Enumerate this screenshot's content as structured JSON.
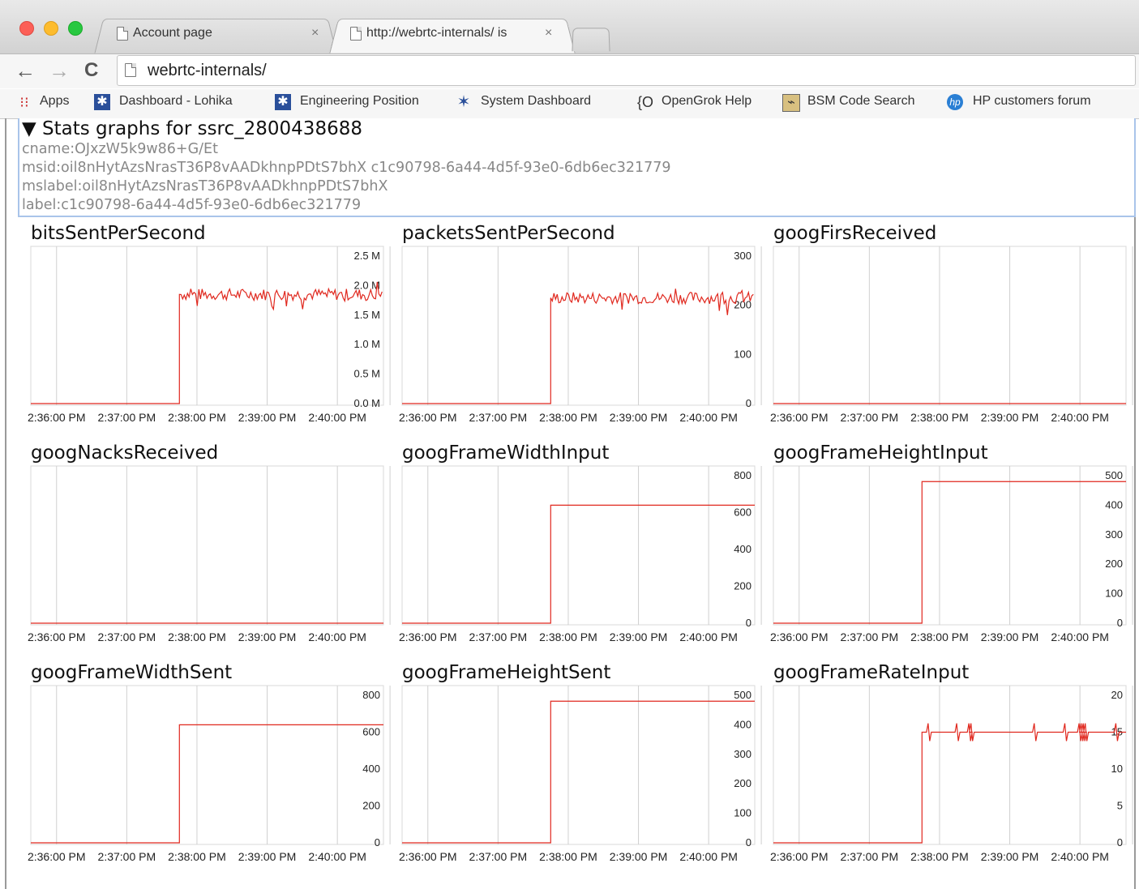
{
  "browser": {
    "tabs": [
      {
        "title": "Account page",
        "close": "×"
      },
      {
        "title": "http://webrtc-internals/ is",
        "close": "×"
      }
    ],
    "address": "webrtc-internals/",
    "nav": {
      "back": "←",
      "forward": "→",
      "reload": "C"
    },
    "bookmarks": [
      "Apps",
      "Dashboard - Lohika",
      "Engineering Position",
      "System Dashboard",
      "OpenGrok Help",
      "BSM Code Search",
      "HP customers forum"
    ]
  },
  "stats": {
    "header": "▼ Stats graphs for ssrc_2800438688",
    "cname": "cname:OJxzW5k9w86+G/Et",
    "msid": "msid:oil8nHytAzsNrasT36P8vAADkhnpPDtS7bhX c1c90798-6a44-4d5f-93e0-6db6ec321779",
    "mslabel": "mslabel:oil8nHytAzsNrasT36P8vAADkhnpPDtS7bhX",
    "label": "label:c1c90798-6a44-4d5f-93e0-6db6ec321779"
  },
  "chart_data": [
    {
      "type": "line",
      "title": "bitsSentPerSecond",
      "x": [
        "2:36:00 PM",
        "2:37:00 PM",
        "2:38:00 PM",
        "2:39:00 PM",
        "2:40:00 PM"
      ],
      "y_ticks": [
        "0.0 M",
        "0.5 M",
        "1.0 M",
        "1.5 M",
        "2.0 M",
        "2.5 M"
      ],
      "ylim": [
        0,
        2.5
      ],
      "step_at": "2:37:45 PM",
      "before": 0,
      "after": 1.85,
      "noise": "high",
      "color": "#e0281e"
    },
    {
      "type": "line",
      "title": "packetsSentPerSecond",
      "x": [
        "2:36:00 PM",
        "2:37:00 PM",
        "2:38:00 PM",
        "2:39:00 PM",
        "2:40:00 PM"
      ],
      "y_ticks": [
        "0",
        "100",
        "200",
        "300"
      ],
      "ylim": [
        0,
        300
      ],
      "step_at": "2:37:45 PM",
      "before": 0,
      "after": 215,
      "noise": "high",
      "color": "#e0281e"
    },
    {
      "type": "line",
      "title": "googFirsReceived",
      "x": [
        "2:36:00 PM",
        "2:37:00 PM",
        "2:38:00 PM",
        "2:39:00 PM",
        "2:40:00 PM"
      ],
      "y_ticks": [],
      "ylim": [
        0,
        1
      ],
      "before": 0,
      "after": 0,
      "color": "#e0281e"
    },
    {
      "type": "line",
      "title": "googNacksReceived",
      "x": [
        "2:36:00 PM",
        "2:37:00 PM",
        "2:38:00 PM",
        "2:39:00 PM",
        "2:40:00 PM"
      ],
      "y_ticks": [],
      "ylim": [
        0,
        1
      ],
      "before": 0,
      "after": 0,
      "color": "#e0281e"
    },
    {
      "type": "line",
      "title": "googFrameWidthInput",
      "x": [
        "2:36:00 PM",
        "2:37:00 PM",
        "2:38:00 PM",
        "2:39:00 PM",
        "2:40:00 PM"
      ],
      "y_ticks": [
        "0",
        "200",
        "400",
        "600",
        "800"
      ],
      "ylim": [
        0,
        800
      ],
      "step_at": "2:37:45 PM",
      "before": 0,
      "after": 640,
      "color": "#e0281e"
    },
    {
      "type": "line",
      "title": "googFrameHeightInput",
      "x": [
        "2:36:00 PM",
        "2:37:00 PM",
        "2:38:00 PM",
        "2:39:00 PM",
        "2:40:00 PM"
      ],
      "y_ticks": [
        "0",
        "100",
        "200",
        "300",
        "400",
        "500"
      ],
      "ylim": [
        0,
        500
      ],
      "step_at": "2:37:45 PM",
      "before": 0,
      "after": 480,
      "color": "#e0281e"
    },
    {
      "type": "line",
      "title": "googFrameWidthSent",
      "x": [
        "2:36:00 PM",
        "2:37:00 PM",
        "2:38:00 PM",
        "2:39:00 PM",
        "2:40:00 PM"
      ],
      "y_ticks": [
        "0",
        "200",
        "400",
        "600",
        "800"
      ],
      "ylim": [
        0,
        800
      ],
      "step_at": "2:37:45 PM",
      "before": 0,
      "after": 640,
      "color": "#e0281e"
    },
    {
      "type": "line",
      "title": "googFrameHeightSent",
      "x": [
        "2:36:00 PM",
        "2:37:00 PM",
        "2:38:00 PM",
        "2:39:00 PM",
        "2:40:00 PM"
      ],
      "y_ticks": [
        "0",
        "100",
        "200",
        "300",
        "400",
        "500"
      ],
      "ylim": [
        0,
        500
      ],
      "step_at": "2:37:45 PM",
      "before": 0,
      "after": 480,
      "color": "#e0281e"
    },
    {
      "type": "line",
      "title": "googFrameRateInput",
      "x": [
        "2:36:00 PM",
        "2:37:00 PM",
        "2:38:00 PM",
        "2:39:00 PM",
        "2:40:00 PM"
      ],
      "y_ticks": [
        "0",
        "5",
        "10",
        "15",
        "20"
      ],
      "ylim": [
        0,
        20
      ],
      "step_at": "2:37:45 PM",
      "before": 0,
      "after": 15,
      "noise": "spikes",
      "color": "#e0281e"
    }
  ]
}
